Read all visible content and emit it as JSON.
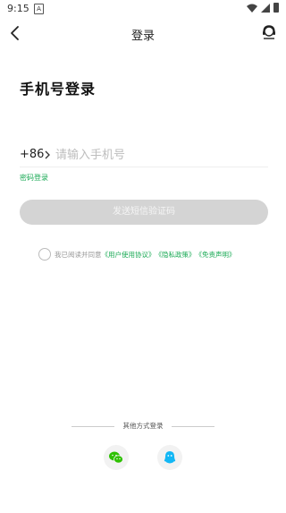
{
  "status_bar": {
    "time": "9:15",
    "notif_glyph": "A"
  },
  "header": {
    "title": "登录",
    "back_icon": "back-arrow-icon",
    "service_icon": "customer-service-icon"
  },
  "heading": "手机号登录",
  "phone": {
    "country_code": "+86",
    "placeholder": "请输入手机号",
    "value": ""
  },
  "password_login_link": "密码登录",
  "send_code_button": "发送短信验证码",
  "agreement": {
    "prefix": "我已阅读并同意",
    "links": [
      "《用户使用协议》",
      "《隐私政策》",
      "《免责声明》"
    ]
  },
  "other_login": {
    "label": "其他方式登录",
    "methods": [
      "wechat-icon",
      "qq-icon"
    ]
  },
  "colors": {
    "accent": "#1aaa55",
    "button_disabled": "#d4d4d4",
    "placeholder": "#bdbdbd"
  }
}
